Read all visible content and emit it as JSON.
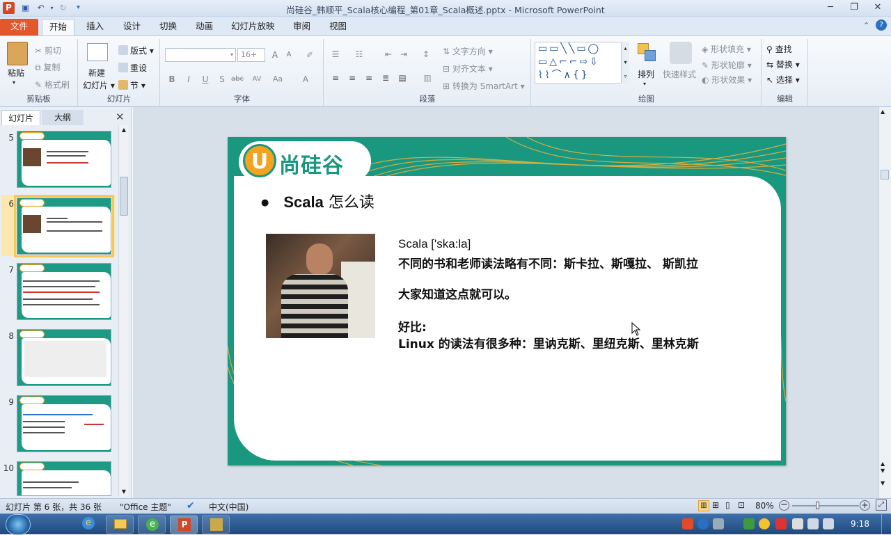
{
  "window": {
    "title": "尚硅谷_韩顺平_Scala核心编程_第01章_Scala概述.pptx - Microsoft PowerPoint"
  },
  "tabs": [
    {
      "label": "文件"
    },
    {
      "label": "开始"
    },
    {
      "label": "插入"
    },
    {
      "label": "设计"
    },
    {
      "label": "切换"
    },
    {
      "label": "动画"
    },
    {
      "label": "幻灯片放映"
    },
    {
      "label": "审阅"
    },
    {
      "label": "视图"
    }
  ],
  "ribbon": {
    "clipboard": {
      "paste": "粘贴",
      "cut": "剪切",
      "copy": "复制",
      "format_painter": "格式刷",
      "label": "剪贴板"
    },
    "slides": {
      "new_slide_1": "新建",
      "new_slide_2": "幻灯片",
      "layout": "版式",
      "reset": "重设",
      "section": "节",
      "label": "幻灯片"
    },
    "font": {
      "size": "16+",
      "label": "字体"
    },
    "paragraph": {
      "text_direction": "文字方向",
      "align_text": "对齐文本",
      "smartart": "转换为 SmartArt",
      "label": "段落"
    },
    "drawing": {
      "arrange": "排列",
      "quick_styles": "快速样式",
      "shape_fill": "形状填充",
      "shape_outline": "形状轮廓",
      "shape_effects": "形状效果",
      "label": "绘图"
    },
    "editing": {
      "find": "查找",
      "replace": "替换",
      "select": "选择",
      "label": "编辑"
    }
  },
  "panel": {
    "tabs": [
      "幻灯片",
      "大纲"
    ],
    "slide_numbers": [
      "5",
      "6",
      "7",
      "8",
      "9",
      "10"
    ],
    "selected": "6"
  },
  "slide": {
    "logo_text": "尚硅谷",
    "bullet_prefix": "●",
    "bullet_en": "Scala",
    "bullet_zh": "怎么读",
    "lines": {
      "pron": "Scala ['ska:la]",
      "diff": "不同的书和老师读法略有不同：斯卡拉、斯嘎拉、 斯凯拉",
      "know": "大家知道这点就可以。",
      "like": "好比:",
      "linux": "Linux 的读法有很多种：里讷克斯、里纽克斯、里林克斯"
    }
  },
  "status": {
    "slide_info": "幻灯片 第 6 张，共 36 张",
    "theme": "\"Office 主题\"",
    "lang": "中文(中国)",
    "zoom": "80%",
    "zoom_level_percent": 80
  },
  "taskbar": {
    "clock": "9:18"
  },
  "colors": {
    "slide_green": "#1a977f",
    "logo_orange": "#f3a31f",
    "file_tab": "#e2572b"
  }
}
